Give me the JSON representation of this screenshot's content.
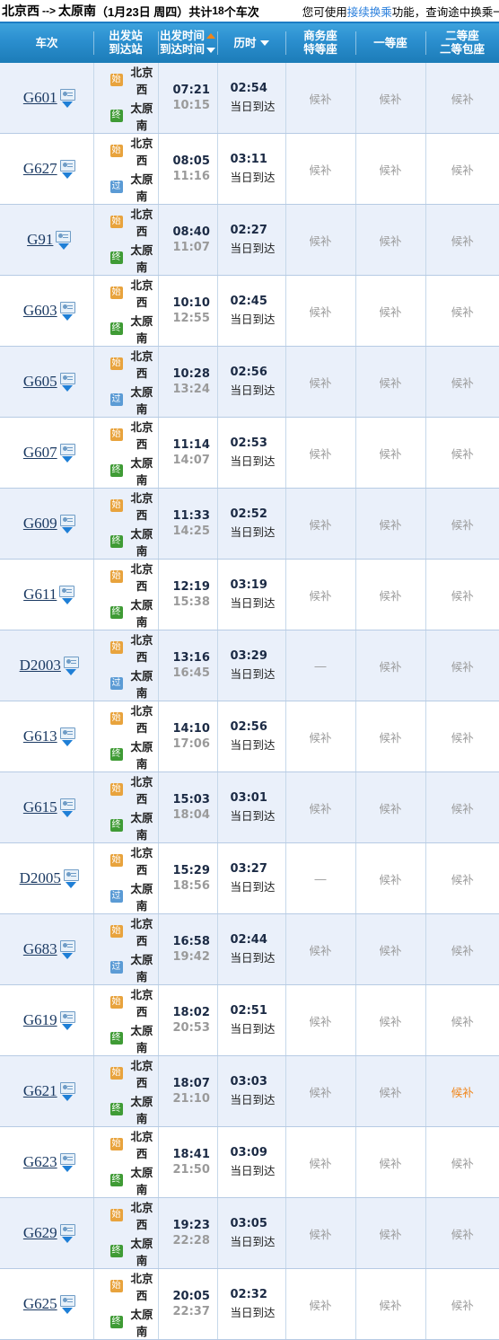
{
  "header": {
    "from_station": "北京西",
    "arrow": "-->",
    "to_station": "太原南",
    "date": "（1月23日  周四）",
    "count_prefix": "共计",
    "count": "18",
    "count_suffix": "个车次",
    "tip_before": "您可使用",
    "tip_link": "接续换乘",
    "tip_after": "功能，查询途中换乘一次的"
  },
  "columns": {
    "train_no": "车次",
    "station_dep": "出发站",
    "station_arr": "到达站",
    "time_dep": "出发时间",
    "time_arr": "到达时间",
    "duration": "历时",
    "business_1": "商务座",
    "business_2": "特等座",
    "first_class": "一等座",
    "second_1": "二等座",
    "second_2": "二等包座"
  },
  "labels": {
    "same_day": "当日到达",
    "waitlist": "候补",
    "unavailable": "—",
    "icon_start": "始",
    "icon_end": "终",
    "icon_pass": "过"
  },
  "colors": {
    "header_blue": "#2c90d0",
    "link_blue": "#2a7fdc",
    "accent_orange": "#f08519",
    "icon_start": "#e8a33d",
    "icon_end": "#3f9b35",
    "icon_pass": "#5b9bd5",
    "row_alt": "#eaf0fa"
  },
  "rows": [
    {
      "train": "G601",
      "dep_station": "北京西",
      "arr_station": "太原南",
      "dep_icon": "始",
      "arr_icon": "终",
      "dep_time": "07:21",
      "arr_time": "10:15",
      "duration": "02:54",
      "day_note": "当日到达",
      "business": "候补",
      "first": "候补",
      "second": "候补",
      "second_hl": false
    },
    {
      "train": "G627",
      "dep_station": "北京西",
      "arr_station": "太原南",
      "dep_icon": "始",
      "arr_icon": "过",
      "dep_time": "08:05",
      "arr_time": "11:16",
      "duration": "03:11",
      "day_note": "当日到达",
      "business": "候补",
      "first": "候补",
      "second": "候补",
      "second_hl": false
    },
    {
      "train": "G91",
      "dep_station": "北京西",
      "arr_station": "太原南",
      "dep_icon": "始",
      "arr_icon": "终",
      "dep_time": "08:40",
      "arr_time": "11:07",
      "duration": "02:27",
      "day_note": "当日到达",
      "business": "候补",
      "first": "候补",
      "second": "候补",
      "second_hl": false
    },
    {
      "train": "G603",
      "dep_station": "北京西",
      "arr_station": "太原南",
      "dep_icon": "始",
      "arr_icon": "终",
      "dep_time": "10:10",
      "arr_time": "12:55",
      "duration": "02:45",
      "day_note": "当日到达",
      "business": "候补",
      "first": "候补",
      "second": "候补",
      "second_hl": false
    },
    {
      "train": "G605",
      "dep_station": "北京西",
      "arr_station": "太原南",
      "dep_icon": "始",
      "arr_icon": "过",
      "dep_time": "10:28",
      "arr_time": "13:24",
      "duration": "02:56",
      "day_note": "当日到达",
      "business": "候补",
      "first": "候补",
      "second": "候补",
      "second_hl": false
    },
    {
      "train": "G607",
      "dep_station": "北京西",
      "arr_station": "太原南",
      "dep_icon": "始",
      "arr_icon": "终",
      "dep_time": "11:14",
      "arr_time": "14:07",
      "duration": "02:53",
      "day_note": "当日到达",
      "business": "候补",
      "first": "候补",
      "second": "候补",
      "second_hl": false
    },
    {
      "train": "G609",
      "dep_station": "北京西",
      "arr_station": "太原南",
      "dep_icon": "始",
      "arr_icon": "终",
      "dep_time": "11:33",
      "arr_time": "14:25",
      "duration": "02:52",
      "day_note": "当日到达",
      "business": "候补",
      "first": "候补",
      "second": "候补",
      "second_hl": false
    },
    {
      "train": "G611",
      "dep_station": "北京西",
      "arr_station": "太原南",
      "dep_icon": "始",
      "arr_icon": "终",
      "dep_time": "12:19",
      "arr_time": "15:38",
      "duration": "03:19",
      "day_note": "当日到达",
      "business": "候补",
      "first": "候补",
      "second": "候补",
      "second_hl": false
    },
    {
      "train": "D2003",
      "dep_station": "北京西",
      "arr_station": "太原南",
      "dep_icon": "始",
      "arr_icon": "过",
      "dep_time": "13:16",
      "arr_time": "16:45",
      "duration": "03:29",
      "day_note": "当日到达",
      "business": "—",
      "first": "候补",
      "second": "候补",
      "second_hl": false
    },
    {
      "train": "G613",
      "dep_station": "北京西",
      "arr_station": "太原南",
      "dep_icon": "始",
      "arr_icon": "终",
      "dep_time": "14:10",
      "arr_time": "17:06",
      "duration": "02:56",
      "day_note": "当日到达",
      "business": "候补",
      "first": "候补",
      "second": "候补",
      "second_hl": false
    },
    {
      "train": "G615",
      "dep_station": "北京西",
      "arr_station": "太原南",
      "dep_icon": "始",
      "arr_icon": "终",
      "dep_time": "15:03",
      "arr_time": "18:04",
      "duration": "03:01",
      "day_note": "当日到达",
      "business": "候补",
      "first": "候补",
      "second": "候补",
      "second_hl": false
    },
    {
      "train": "D2005",
      "dep_station": "北京西",
      "arr_station": "太原南",
      "dep_icon": "始",
      "arr_icon": "过",
      "dep_time": "15:29",
      "arr_time": "18:56",
      "duration": "03:27",
      "day_note": "当日到达",
      "business": "—",
      "first": "候补",
      "second": "候补",
      "second_hl": false
    },
    {
      "train": "G683",
      "dep_station": "北京西",
      "arr_station": "太原南",
      "dep_icon": "始",
      "arr_icon": "过",
      "dep_time": "16:58",
      "arr_time": "19:42",
      "duration": "02:44",
      "day_note": "当日到达",
      "business": "候补",
      "first": "候补",
      "second": "候补",
      "second_hl": false
    },
    {
      "train": "G619",
      "dep_station": "北京西",
      "arr_station": "太原南",
      "dep_icon": "始",
      "arr_icon": "终",
      "dep_time": "18:02",
      "arr_time": "20:53",
      "duration": "02:51",
      "day_note": "当日到达",
      "business": "候补",
      "first": "候补",
      "second": "候补",
      "second_hl": false
    },
    {
      "train": "G621",
      "dep_station": "北京西",
      "arr_station": "太原南",
      "dep_icon": "始",
      "arr_icon": "终",
      "dep_time": "18:07",
      "arr_time": "21:10",
      "duration": "03:03",
      "day_note": "当日到达",
      "business": "候补",
      "first": "候补",
      "second": "候补",
      "second_hl": true
    },
    {
      "train": "G623",
      "dep_station": "北京西",
      "arr_station": "太原南",
      "dep_icon": "始",
      "arr_icon": "终",
      "dep_time": "18:41",
      "arr_time": "21:50",
      "duration": "03:09",
      "day_note": "当日到达",
      "business": "候补",
      "first": "候补",
      "second": "候补",
      "second_hl": false
    },
    {
      "train": "G629",
      "dep_station": "北京西",
      "arr_station": "太原南",
      "dep_icon": "始",
      "arr_icon": "终",
      "dep_time": "19:23",
      "arr_time": "22:28",
      "duration": "03:05",
      "day_note": "当日到达",
      "business": "候补",
      "first": "候补",
      "second": "候补",
      "second_hl": false
    },
    {
      "train": "G625",
      "dep_station": "北京西",
      "arr_station": "太原南",
      "dep_icon": "始",
      "arr_icon": "终",
      "dep_time": "20:05",
      "arr_time": "22:37",
      "duration": "02:32",
      "day_note": "当日到达",
      "business": "候补",
      "first": "候补",
      "second": "候补",
      "second_hl": false
    }
  ]
}
